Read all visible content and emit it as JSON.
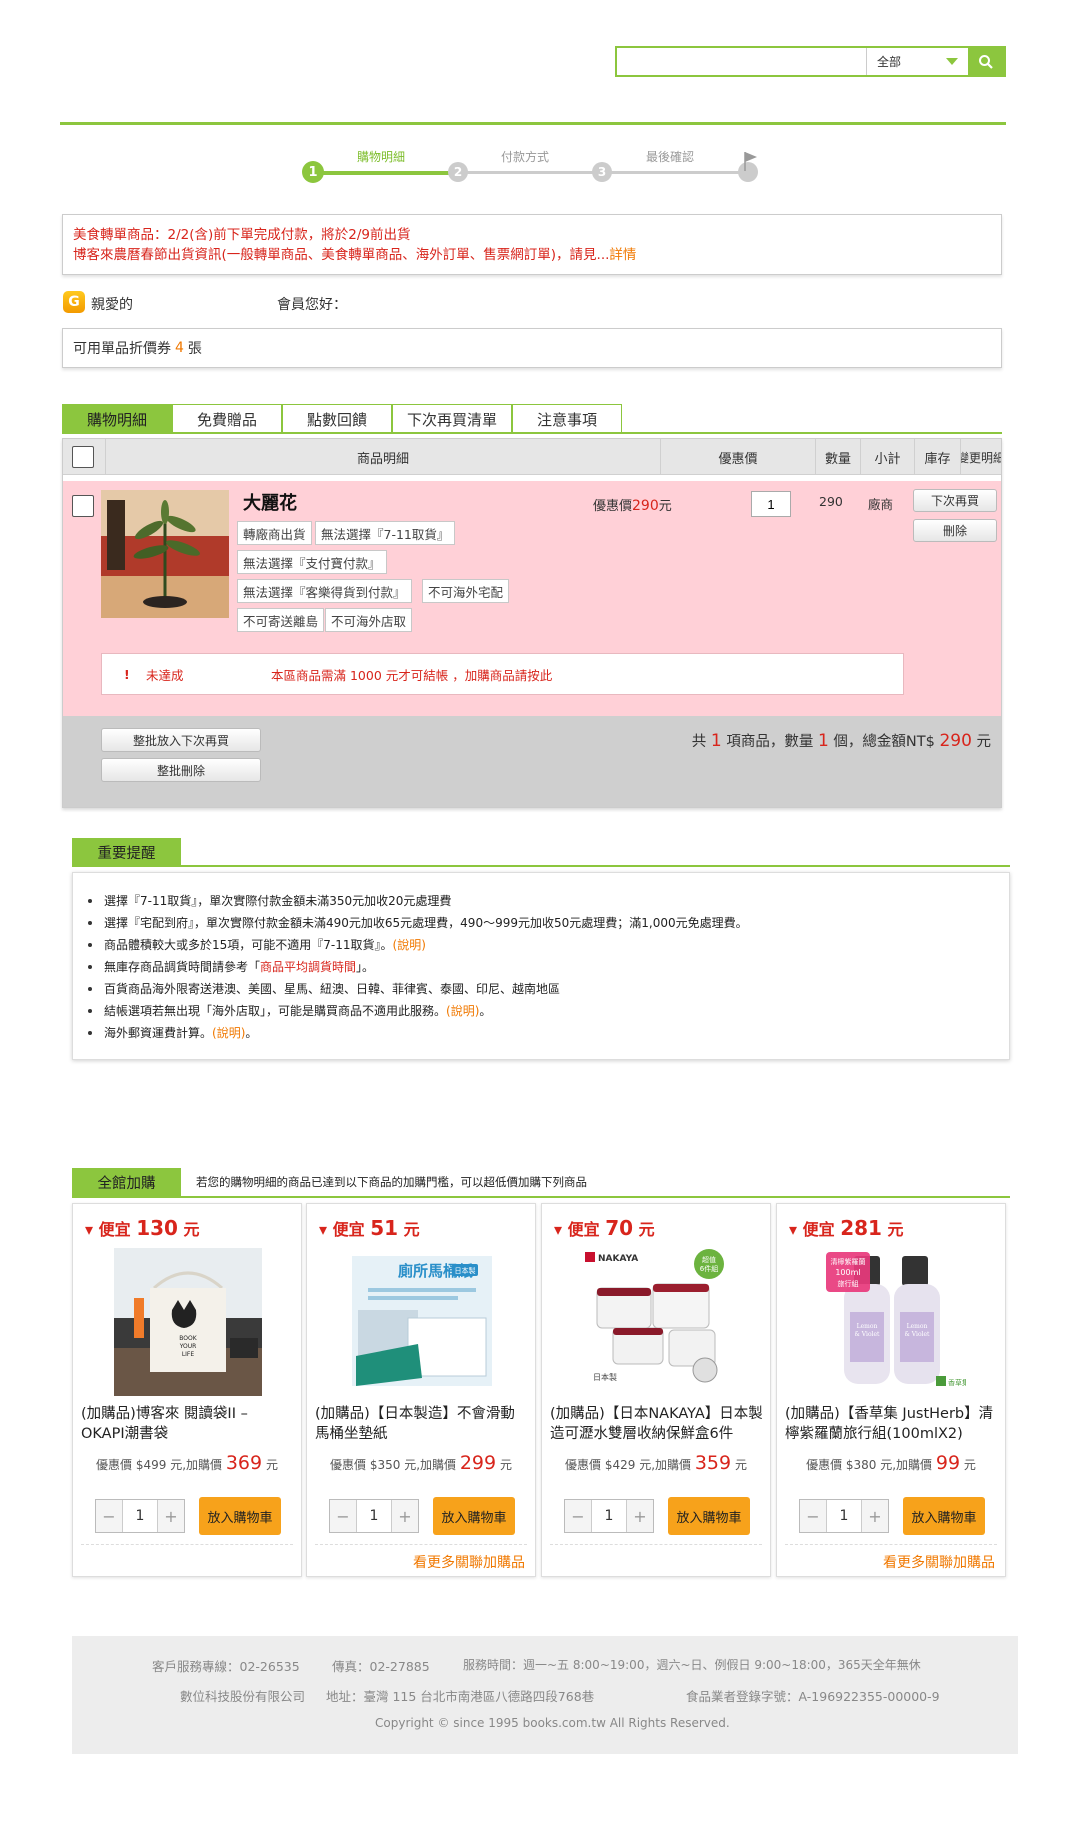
{
  "search": {
    "placeholder": "",
    "category": "全部"
  },
  "steps": [
    {
      "num": "1",
      "label": "購物明細"
    },
    {
      "num": "2",
      "label": "付款方式"
    },
    {
      "num": "3",
      "label": "最後確認"
    }
  ],
  "announce": {
    "line1": "美食轉單商品：2/2(含)前下單完成付款，將於2/9前出貨",
    "line2": "博客來農曆春節出貨資訊(一般轉單商品、美食轉單商品、海外訂單、售票網訂單)，請見...",
    "line2_link": "詳情"
  },
  "greeting": {
    "badge": "G",
    "dear": "親愛的",
    "member": "會員您好："
  },
  "coupon": {
    "text": "可用單品折價券",
    "count": "4",
    "unit": "張"
  },
  "tabs": [
    "購物明細",
    "免費贈品",
    "點數回饋",
    "下次再買清單",
    "注意事項"
  ],
  "table_headers": {
    "product": "商品明細",
    "discount": "優惠價",
    "qty": "數量",
    "subtotal": "小計",
    "stock": "庫存",
    "change": "變更明細"
  },
  "item": {
    "name": "大麗花",
    "price_label": "優惠價",
    "price": "290",
    "price_unit": "元",
    "qty": "1",
    "subtotal": "290",
    "stock": "廠商",
    "next_buy": "下次再買",
    "delete": "刪除",
    "tags": [
      "轉廠商出貨",
      "無法選擇『7-11取貨』",
      "無法選擇『支付寶付款』",
      "無法選擇『客樂得貨到付款』",
      "不可海外宅配",
      "不可寄送離島",
      "不可海外店取"
    ],
    "warn_mark": "!",
    "warn_status": "未達成",
    "warn_text": "本區商品需滿 1000 元才可結帳 ，加購商品請按此"
  },
  "batch": {
    "move": "整批放入下次再買",
    "delete": "整批刪除"
  },
  "summary": {
    "p1": "共",
    "count": "1",
    "p2": "項商品，數量",
    "qty": "1",
    "p3": "個，總金額NT$",
    "total": "290",
    "p4": "元"
  },
  "notice": {
    "title": "重要提醒",
    "items": [
      {
        "text": "選擇『7-11取貨』，單次實際付款金額未滿350元加收20元處理費"
      },
      {
        "text": "選擇『宅配到府』，單次實際付款金額未滿490元加收65元處理費，490～999元加收50元處理費；滿1,000元免處理費。"
      },
      {
        "text": "商品體積較大或多於15項，可能不適用『7-11取貨』。",
        "link": "(說明)"
      },
      {
        "text": "無庫存商品調貨時間請參考「",
        "highlight": "商品平均調貨時間",
        "after": "」。"
      },
      {
        "text": "百貨商品海外限寄送港澳、美國、星馬、紐澳、日韓、菲律賓、泰國、印尼、越南地區"
      },
      {
        "text": "結帳選項若無出現「海外店取」，可能是購買商品不適用此服務。",
        "link": "(說明)",
        "after": "。"
      },
      {
        "text": "海外郵資運費計算。",
        "link": "(說明)",
        "after": "。"
      }
    ]
  },
  "addon": {
    "title": "全館加購",
    "desc": "若您的購物明細的商品已達到以下商品的加購門檻，可以超低價加購下列商品",
    "save_prefix": "便宜",
    "save_unit": "元",
    "add_label": "放入購物車",
    "more_label": "看更多關聯加購品",
    "cards": [
      {
        "save": "130",
        "name": "(加購品)博客來 閱讀袋II – OKAPI潮書袋",
        "orig": "優惠價 $499 元,加購價",
        "price": "369",
        "unit": "元",
        "qty": "1",
        "book_text": "BOOK\nYOUR\nLIFE"
      },
      {
        "save": "51",
        "name": "(加購品)【日本製造】不會滑動馬桶坐墊紙",
        "orig": "優惠價 $350 元,加購價",
        "price": "299",
        "unit": "元",
        "qty": "1",
        "pkg_title": "廁所馬桶紙",
        "pkg_badge": "日本製"
      },
      {
        "save": "70",
        "name": "(加購品)【日本NAKAYA】日本製造可瀝水雙層收納保鮮盒6件",
        "orig": "優惠價 $429 元,加購價",
        "price": "359",
        "unit": "元",
        "qty": "1",
        "brand": "NAKAYA",
        "badge": "超值\n6件組",
        "jp_mark": "日本製"
      },
      {
        "save": "281",
        "name": "(加購品)【香草集 JustHerb】清檸紫羅蘭旅行組(100mlX2)",
        "orig": "優惠價 $380 元,加購價",
        "price": "99",
        "unit": "元",
        "qty": "1",
        "label": "清檸紫羅蘭\n100ml\n旅行組",
        "bottle": "Lemon\n& Violet",
        "brand": "香草集"
      }
    ]
  },
  "footer": {
    "line1": [
      "客戶服務專線：02-26535",
      "傳真：02-27885",
      "服務時間：週一~五 8:00~19:00，週六~日、例假日 9:00~18:00，365天全年無休"
    ],
    "line2": [
      "數位科技股份有限公司",
      "地址：臺灣 115 台北市南港區八德路四段768巷",
      "食品業者登錄字號：A-196922355-00000-9"
    ],
    "copyright": "Copyright © since 1995 books.com.tw All Rights Reserved."
  },
  "colors": {
    "accent": "#8cc63e",
    "price": "#d8251c",
    "orange": "#f07800",
    "item_bg": "#ffd0d7"
  }
}
